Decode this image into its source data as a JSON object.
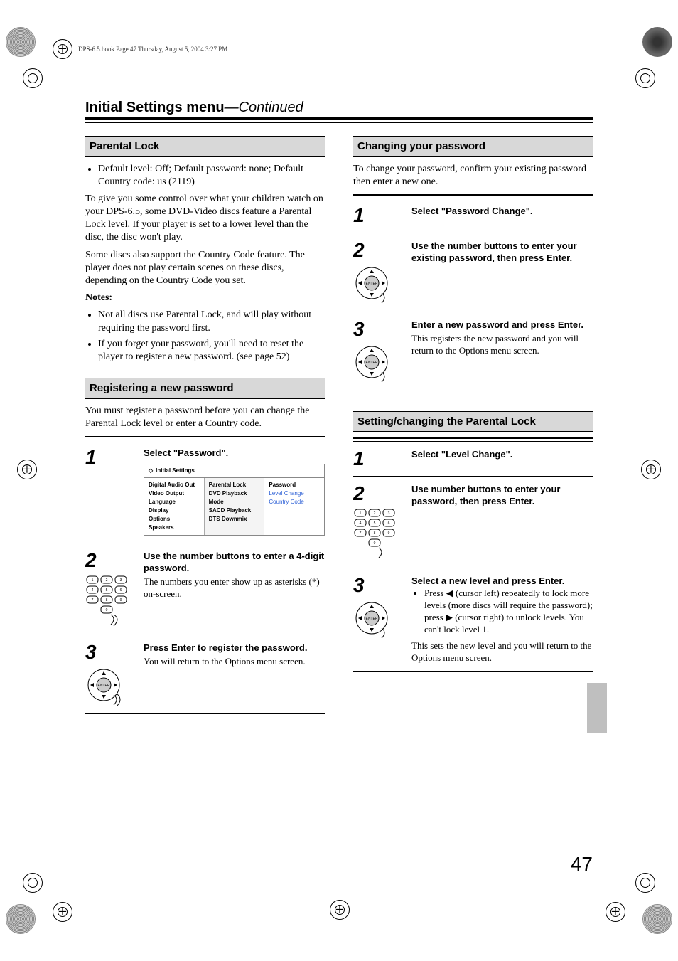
{
  "header_runner": "DPS-6.5.book  Page 47  Thursday, August 5, 2004  3:27 PM",
  "page_title_main": "Initial Settings menu",
  "page_title_cont": "—Continued",
  "page_number": "47",
  "left": {
    "section1_head": "Parental Lock",
    "section1_bullet": "Default level: Off; Default password: none; Default Country code: us (2119)",
    "section1_p1": "To give you some control over what your children watch on your DPS-6.5, some DVD-Video discs feature a Parental Lock level. If your player is set to a lower level than the disc, the disc won't play.",
    "section1_p2": "Some discs also support the Country Code feature. The player does not play certain scenes on these discs, depending on the Country Code you set.",
    "notes_label": "Notes:",
    "notes": {
      "n1": "Not all discs use Parental Lock, and will play without requiring the password first.",
      "n2": "If you forget your password, you'll need to reset the player to register a new password. (see page 52)"
    },
    "section2_head": "Registering a new password",
    "section2_intro": "You must register a password before you can change the Parental Lock level or enter a Country code.",
    "steps": {
      "s1_bold": "Select \"Password\".",
      "menu_title": "Initial Settings",
      "menu_c1": {
        "a": "Digital Audio Out",
        "b": "Video Output",
        "c": "Language",
        "d": "Display",
        "e": "Options",
        "f": "Speakers"
      },
      "menu_c2": {
        "a": "Parental Lock",
        "b": "DVD Playback Mode",
        "c": "SACD Playback",
        "d": "DTS Downmix"
      },
      "menu_c3": {
        "a": "Password",
        "b": "Level Change",
        "c": "Country Code"
      },
      "s2_bold": "Use the number buttons to enter a 4-digit password.",
      "s2_body": "The numbers you enter show up as asterisks (*) on-screen.",
      "s3_bold": "Press Enter to register the password.",
      "s3_body": "You will return to the Options menu screen."
    }
  },
  "right": {
    "section3_head": "Changing your password",
    "section3_intro": "To change your password, confirm your existing password then enter a new one.",
    "steps3": {
      "s1_bold": "Select \"Password Change\".",
      "s2_bold": "Use the number buttons to enter your existing password, then press Enter.",
      "s3_bold": "Enter a new password and press Enter.",
      "s3_body": "This registers the new password and you will return to the Options menu screen."
    },
    "section4_head": "Setting/changing the Parental Lock",
    "steps4": {
      "s1_bold": "Select \"Level Change\".",
      "s2_bold": "Use number buttons to enter your password, then press Enter.",
      "s3_bold": "Select a new level and press Enter.",
      "s3_bullet_pre": "Press ",
      "s3_bullet_mid": " (cursor left) repeatedly to lock more levels (more discs will require the password); press ",
      "s3_bullet_post": " (cursor right) to unlock levels. You can't lock level 1.",
      "s3_body2": "This sets the new level and you will return to the Options menu screen."
    }
  }
}
